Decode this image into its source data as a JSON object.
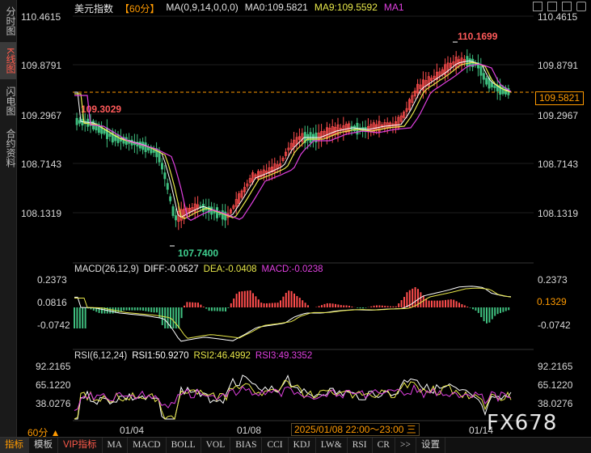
{
  "sidebar": {
    "tabs": [
      {
        "label": "分时图",
        "active": false
      },
      {
        "label": "K线图",
        "active": true
      },
      {
        "label": "闪电图",
        "active": false
      },
      {
        "label": "合约资料",
        "active": false
      }
    ]
  },
  "header": {
    "symbol": "美元指数",
    "period": "【60分】",
    "ma_params": "MA(0,9,14,0,0,0)",
    "ma0": "MA0:109.5821",
    "ma9": "MA9:109.5592",
    "ma1": "MA1"
  },
  "price_axis": {
    "right": [
      "110.4615",
      "109.8791",
      "109.2967",
      "108.7143",
      "108.1319"
    ],
    "left_high": "110.1699",
    "left_mark": "109.3029",
    "low_mark": "107.7400",
    "current": "109.5821"
  },
  "macd": {
    "title": "MACD(26,12,9)",
    "diff": "DIFF:-0.0527",
    "dea": "DEA:-0.0408",
    "macd": "MACD:-0.0238",
    "axis": [
      "0.2373",
      "0.0816",
      "-0.0742"
    ],
    "current": "0.1329"
  },
  "rsi": {
    "title": "RSI(6,12,24)",
    "rsi1": "RSI1:50.9270",
    "rsi2": "RSI2:46.4992",
    "rsi3": "RSI3:49.3352",
    "axis": [
      "92.2165",
      "65.1220",
      "38.0276"
    ]
  },
  "x_axis": {
    "labels": [
      "01/04",
      "01/08",
      "01/14"
    ],
    "cursor_time": "2025/01/08 22:00～23:00 三",
    "period_label": "60分 ▲"
  },
  "bottom_bar": {
    "items": [
      "指标",
      "模板",
      "VIP指标",
      "MA",
      "MACD",
      "BOLL",
      "VOL",
      "BIAS",
      "CCI",
      "KDJ",
      "LW&",
      "RSI",
      "CR",
      ">>",
      "设置"
    ]
  },
  "watermark": "FX678",
  "colors": {
    "up": "#ff4d4d",
    "down": "#3fbf7f",
    "ma_yellow": "#e8e84a",
    "ma_magenta": "#e040e0",
    "accent": "#ff9a00",
    "white_line": "#ffffff"
  }
}
